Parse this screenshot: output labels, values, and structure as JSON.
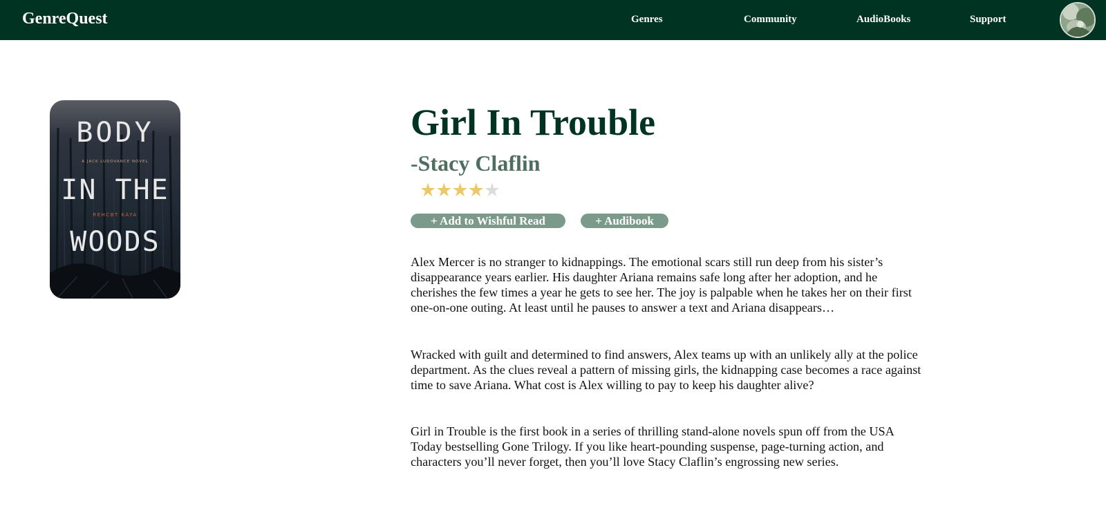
{
  "nav": {
    "brand": "GenreQuest",
    "links": [
      "Genres",
      "Community",
      "AudioBooks",
      "Support"
    ]
  },
  "cover": {
    "words": [
      "BODY",
      "IN THE",
      "WOODS"
    ],
    "series": "A JACK LUDOVANCE NOVEL",
    "author": "REHCBT KAYA"
  },
  "book": {
    "title": "Girl In Trouble",
    "author": "-Stacy Claflin",
    "rating": 4,
    "rating_max": 5
  },
  "actions": {
    "wishlist": "+ Add to Wishful Read",
    "audiobook": "+ Audibook"
  },
  "description": [
    "Alex Mercer is no stranger to kidnappings. The emotional scars still run deep from his sister’s disappearance years earlier. His daughter Ariana remains safe long after her adoption, and he cherishes the few times a year he gets to see her. The joy is palpable when he takes her on their first one-on-one outing. At least until he pauses to answer a text and Ariana disappears…",
    "Wracked with guilt and determined to find answers, Alex teams up with an unlikely ally at the police department. As the clues reveal a pattern of missing girls, the kidnapping case becomes a race against time to save Ariana. What cost is Alex willing to pay to keep his daughter alive?",
    "Girl in Trouble is the first book in a series of thrilling stand-alone novels spun off from the USA Today bestselling Gone Trilogy. If you like heart-pounding suspense, page-turning action, and characters you’ll never forget, then you’ll love Stacy Claflin’s engrossing new series."
  ],
  "colors": {
    "navbar": "#003322",
    "title": "#003322",
    "author": "#4d6e60",
    "button": "#7b9a8c",
    "star_on": "#ebc86a",
    "star_off": "#dcdcdc"
  }
}
